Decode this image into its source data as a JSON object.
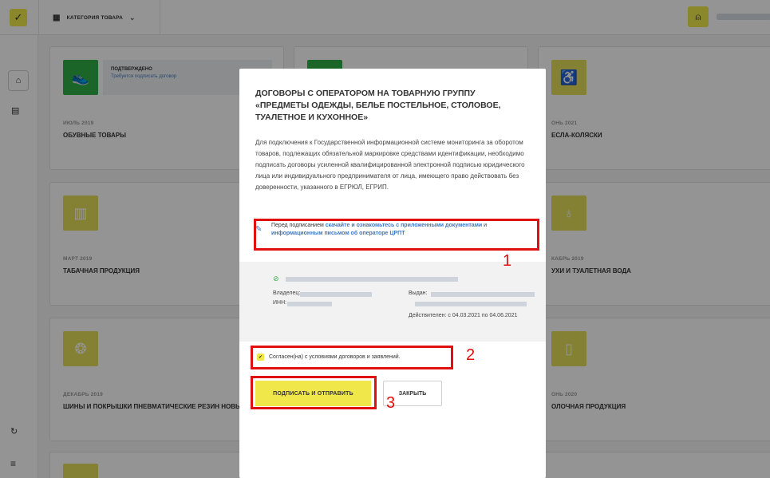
{
  "topbar": {
    "category_label": "КАТЕГОРИЯ ТОВАРА",
    "logo_icon": "check-logo-icon",
    "grid_icon": "grid-icon",
    "user_icon": "user-icon"
  },
  "sidebar": {
    "home_icon": "home-icon",
    "docs_icon": "documents-icon",
    "support_icon": "support-icon",
    "menu_icon": "menu-icon"
  },
  "cards": [
    {
      "status_title": "ПОДТВЕРЖДЕНО",
      "status_sub": "Требуется подписать договор",
      "date": "ИЮЛЬ 2019",
      "title": "ОБУВНЫЕ ТОВАРЫ"
    },
    {
      "date": "ОНЬ 2021",
      "title": "ЕСЛА-КОЛЯСКИ"
    },
    {
      "date": "МАРТ 2019",
      "title": "ТАБАЧНАЯ ПРОДУКЦИЯ"
    },
    {
      "date": "КАБРЬ 2019",
      "title": "УХИ И ТУАЛЕТНАЯ ВОДА"
    },
    {
      "date": "ДЕКАБРЬ 2019",
      "title": "ШИНЫ И ПОКРЫШКИ ПНЕВМАТИЧЕСКИЕ РЕЗИН НОВЫЕ"
    },
    {
      "date": "ОНЬ 2020",
      "title": "ОЛОЧНАЯ ПРОДУКЦИЯ"
    }
  ],
  "modal": {
    "title": "ДОГОВОРЫ С ОПЕРАТОРОМ НА ТОВАРНУЮ ГРУППУ «ПРЕДМЕТЫ ОДЕЖДЫ, БЕЛЬЕ ПОСТЕЛЬНОЕ, СТОЛОВОЕ, ТУАЛЕТНОЕ И КУХОННОЕ»",
    "body": "Для подключения к Государственной информационной системе мониторинга за оборотом товаров, подлежащих обязательной маркировке средствами идентификации, необходимо подписать договоры усиленной квалифицированной электронной подписью юридического лица или индивидуального предпринимателя от лица, имеющего право действовать без доверенности, указанного в ЕГРЮЛ, ЕГРИП.",
    "notice_prefix": "Перед подписанием ",
    "notice_link1": "скачайте и ознакомьтесь с приложенными документами",
    "notice_and": " и ",
    "notice_link2": "информационным письмом об операторе ЦРПТ",
    "cert": {
      "owner_label": "Владелец:",
      "inn_label": "ИНН:",
      "issued_label": "Выдан:",
      "valid": "Действителен: с 04.03.2021 по 04.06.2021"
    },
    "agree_label": "Согласен(на) с условиями договоров и заявлений.",
    "sign_button": "ПОДПИСАТЬ И ОТПРАВИТЬ",
    "close_button": "ЗАКРЫТЬ"
  },
  "annotations": {
    "n1": "1",
    "n2": "2",
    "n3": "3",
    "color": "#e01010"
  }
}
